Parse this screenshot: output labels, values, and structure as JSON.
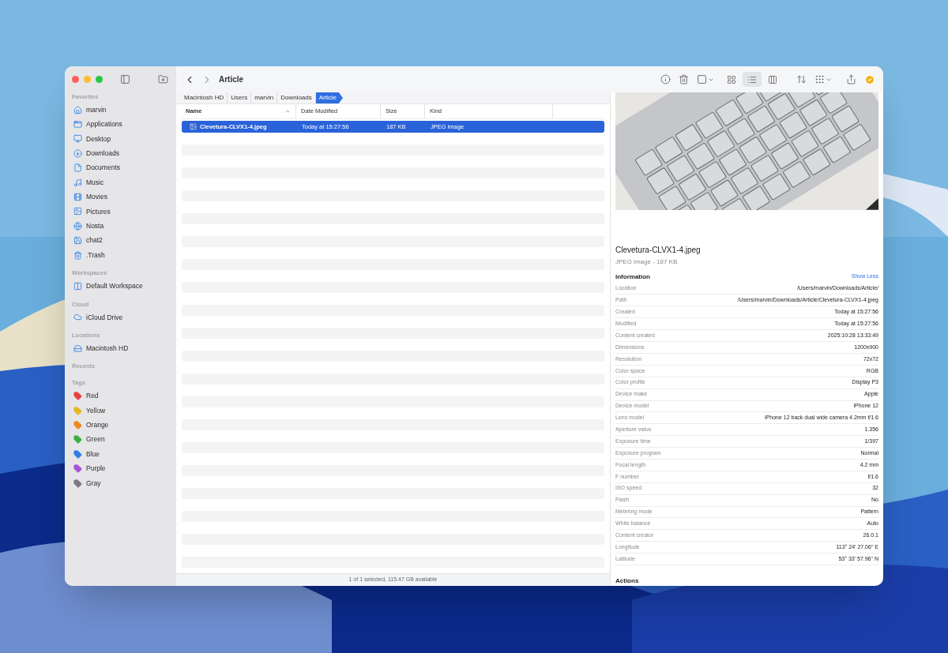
{
  "toolbar": {
    "title": "Article",
    "view_modes": [
      {
        "selected": false
      },
      {
        "selected": true
      },
      {
        "selected": false
      }
    ]
  },
  "sidebar": {
    "sections": [
      {
        "heading": "Favorites",
        "items": [
          {
            "label": "marvin"
          },
          {
            "label": "Applications"
          },
          {
            "label": "Desktop"
          },
          {
            "label": "Downloads"
          },
          {
            "label": "Documents"
          },
          {
            "label": "Music"
          },
          {
            "label": "Movies"
          },
          {
            "label": "Pictures"
          },
          {
            "label": "Nosta"
          },
          {
            "label": "chat2"
          },
          {
            "label": ".Trash"
          }
        ]
      },
      {
        "heading": "Workspaces",
        "items": [
          {
            "label": "Default Workspace"
          }
        ]
      },
      {
        "heading": "Cloud",
        "items": [
          {
            "label": "iCloud Drive"
          }
        ]
      },
      {
        "heading": "Locations",
        "items": [
          {
            "label": "Macintosh HD"
          }
        ]
      },
      {
        "heading": "Recents"
      },
      {
        "heading": "Tags",
        "items": [
          {
            "label": "Red",
            "color": "#e8413c"
          },
          {
            "label": "Yellow",
            "color": "#e6b71e"
          },
          {
            "label": "Orange",
            "color": "#ee8a1e"
          },
          {
            "label": "Green",
            "color": "#3cb043"
          },
          {
            "label": "Blue",
            "color": "#2f7fe6"
          },
          {
            "label": "Purple",
            "color": "#a651d6"
          },
          {
            "label": "Gray",
            "color": "#7a7a7e"
          }
        ]
      }
    ]
  },
  "path_bar": [
    {
      "label": "Macintosh HD",
      "selected": false
    },
    {
      "label": "Users",
      "selected": false
    },
    {
      "label": "marvin",
      "selected": false
    },
    {
      "label": "Downloads",
      "selected": false
    },
    {
      "label": "Article",
      "selected": true
    }
  ],
  "table": {
    "columns": [
      {
        "label": "Name",
        "sorted": true
      },
      {
        "label": "Date Modified",
        "sorted": false
      },
      {
        "label": "Size",
        "sorted": false
      },
      {
        "label": "Kind",
        "sorted": false
      }
    ],
    "rows": [
      {
        "name": "Clevetura-CLVX1-4.jpeg",
        "date": "Today at 15:27:56",
        "size": "187 KB",
        "kind": "JPEG image",
        "selected": true
      }
    ]
  },
  "status_bar": "1 of 1 selected, 115.47 GB available",
  "preview": {
    "filename": "Clevetura-CLVX1-4.jpeg",
    "subtitle": "JPEG image - 187 KB",
    "info_heading": "Information",
    "toggle_label": "Show Less",
    "info": [
      {
        "label": "Location",
        "value": "/Users/marvin/Downloads/Article/"
      },
      {
        "label": "Path",
        "value": "/Users/marvin/Downloads/Article/Clevetura-CLVX1-4.jpeg"
      },
      {
        "label": "Created",
        "value": "Today at 15:27:56"
      },
      {
        "label": "Modified",
        "value": "Today at 15:27:56"
      },
      {
        "label": "Content created",
        "value": "2025:10:28 13:33:49"
      },
      {
        "label": "Dimensions",
        "value": "1200x900"
      },
      {
        "label": "Resolution",
        "value": "72x72"
      },
      {
        "label": "Color space",
        "value": "RGB"
      },
      {
        "label": "Color profile",
        "value": "Display P3"
      },
      {
        "label": "Device make",
        "value": "Apple"
      },
      {
        "label": "Device model",
        "value": "iPhone 12"
      },
      {
        "label": "Lens model",
        "value": "iPhone 12 back dual wide camera 4.2mm f/1.6"
      },
      {
        "label": "Aperture value",
        "value": "1.356"
      },
      {
        "label": "Exposure time",
        "value": "1/397"
      },
      {
        "label": "Exposure program",
        "value": "Normal"
      },
      {
        "label": "Focal length",
        "value": "4.2 mm"
      },
      {
        "label": "F number",
        "value": "f/1.6"
      },
      {
        "label": "ISO speed",
        "value": "32"
      },
      {
        "label": "Flash",
        "value": "No"
      },
      {
        "label": "Metering mode",
        "value": "Pattern"
      },
      {
        "label": "White balance",
        "value": "Auto"
      },
      {
        "label": "Content creator",
        "value": "26.0.1"
      },
      {
        "label": "Longitude",
        "value": "113° 24' 27.06\" E"
      },
      {
        "label": "Latitude",
        "value": "53° 33' 57.96\" N"
      }
    ],
    "actions_heading": "Actions"
  }
}
